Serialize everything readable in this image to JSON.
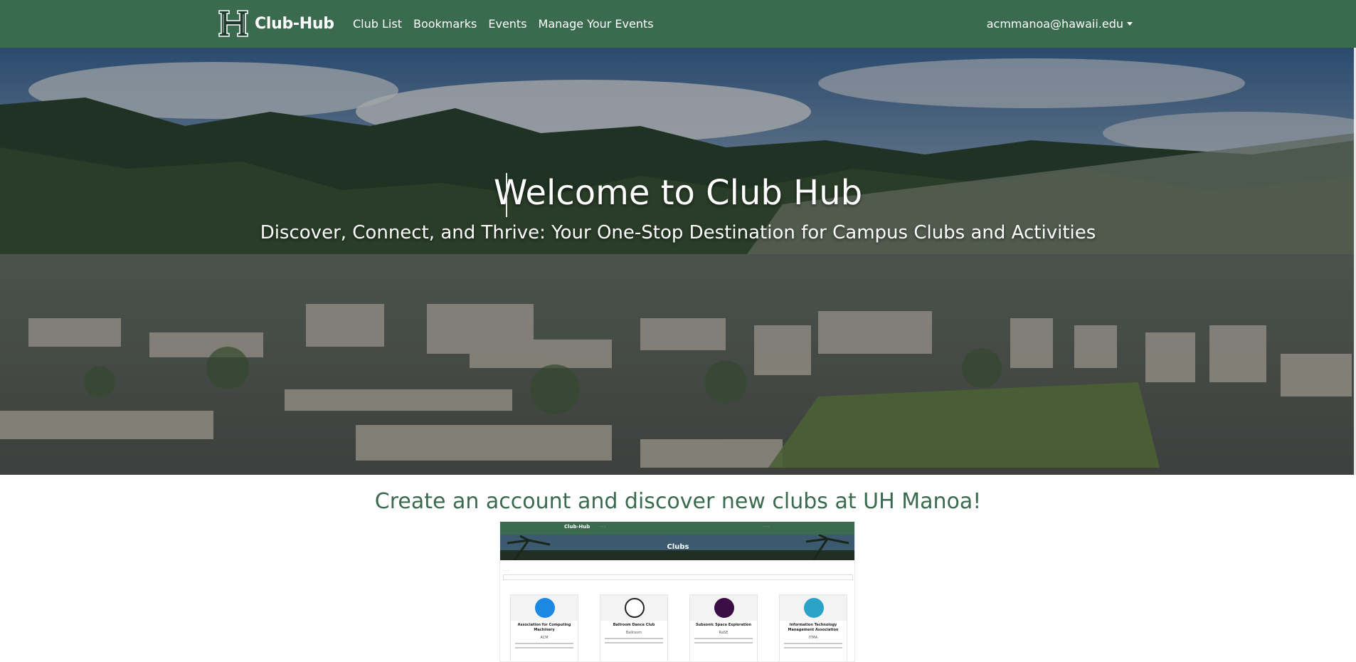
{
  "navbar": {
    "brand": "Club-Hub",
    "links": [
      "Club List",
      "Bookmarks",
      "Events",
      "Manage Your Events"
    ],
    "user_email": "acmmanoa@hawaii.edu",
    "icons": {
      "logo": "uh-h-logo",
      "user_caret": "caret-down-icon"
    }
  },
  "hero": {
    "title": "Welcome to Club Hub",
    "subtitle": "Discover, Connect, and Thrive: Your One-Stop Destination for Campus Clubs and Activities"
  },
  "cta": {
    "heading": "Create an account and discover new clubs at UH Manoa!"
  },
  "preview": {
    "brand": "Club-Hub",
    "hero_title": "Clubs",
    "cards": [
      {
        "name": "Association for Computing Machinery",
        "abbr": "ACM"
      },
      {
        "name": "Ballroom Dance Club",
        "abbr": "Ballroom"
      },
      {
        "name": "Subsonic Space Exploration",
        "abbr": "RaSE"
      },
      {
        "name": "Information Technology Management Association",
        "abbr": "ITMA"
      }
    ]
  },
  "colors": {
    "primary_green": "#3b6b4f",
    "hero_text": "#ffffff"
  }
}
